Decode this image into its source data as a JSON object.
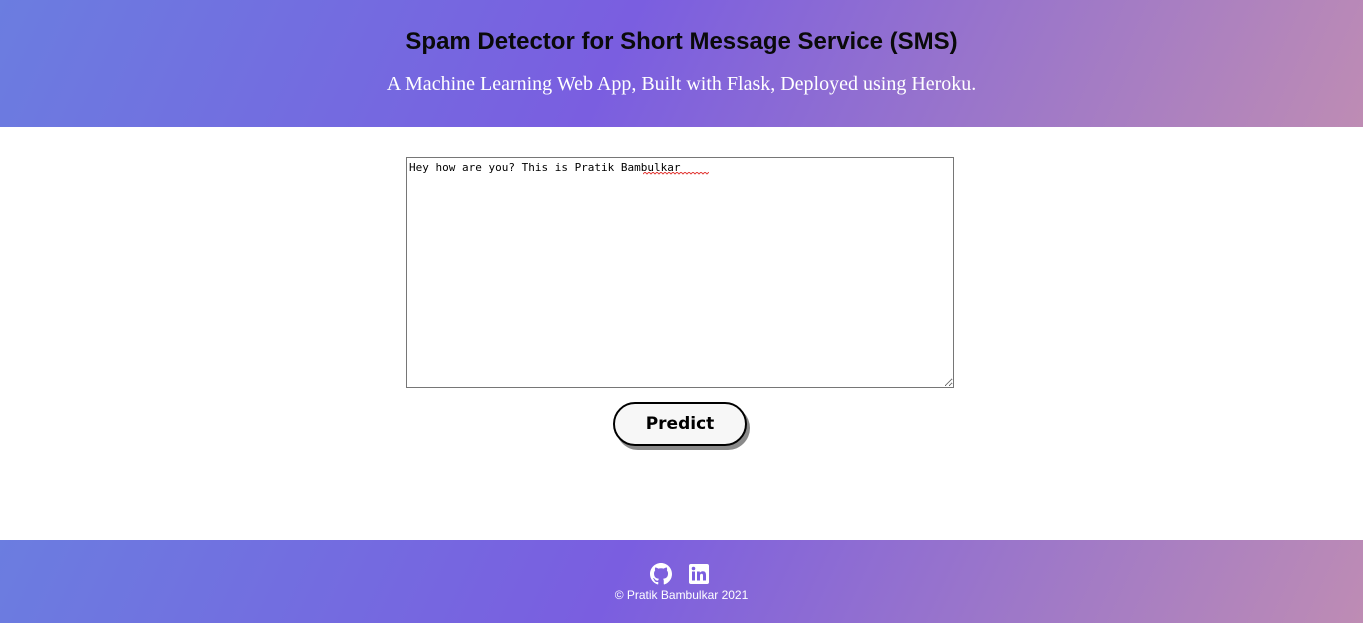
{
  "header": {
    "title": "Spam Detector for Short Message Service (SMS)",
    "subtitle": "A Machine Learning Web App, Built with Flask, Deployed using Heroku."
  },
  "form": {
    "message_value": "Hey how are you? This is Pratik Bambulkar",
    "predict_label": "Predict"
  },
  "footer": {
    "icons": [
      "github-icon",
      "linkedin-icon"
    ],
    "copyright": "© Pratik Bambulkar 2021"
  },
  "colors": {
    "gradient_start": "#6b7de0",
    "gradient_mid": "#7a5ee0",
    "gradient_end": "#be8cb4",
    "button_shadow": "#8a8a8a"
  }
}
